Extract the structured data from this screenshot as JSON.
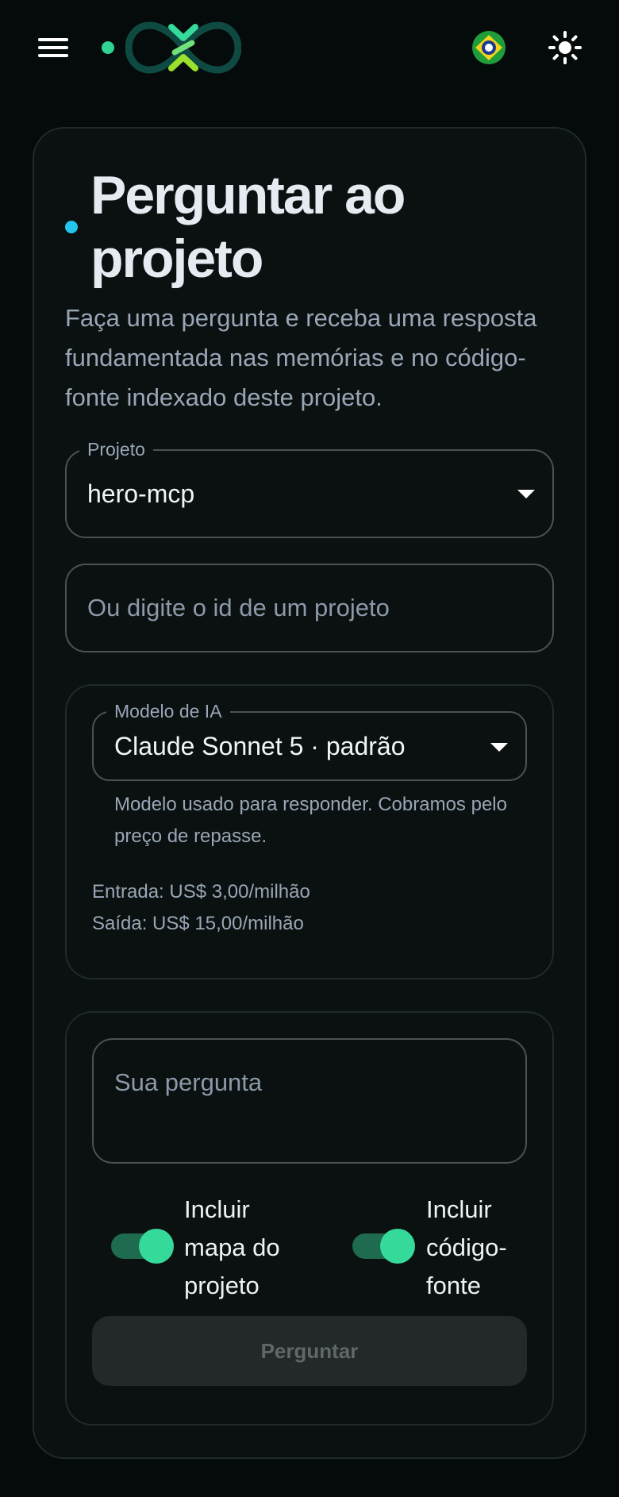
{
  "header": {
    "menu_icon": "hamburger-menu-icon",
    "status_color": "#2fd493",
    "logo_icon": "infinity-logo-icon",
    "language_icon": "brazil-flag-icon",
    "theme_icon": "sun-icon"
  },
  "page": {
    "title": "Perguntar ao projeto",
    "subtitle": "Faça uma pergunta e receba uma resposta fundamentada nas memórias e no código-fonte indexado deste projeto.",
    "accent_color": "#22c5ee"
  },
  "project": {
    "legend": "Projeto",
    "value": "hero-mcp",
    "id_placeholder": "Ou digite o id de um projeto"
  },
  "model": {
    "legend": "Modelo de IA",
    "value": "Claude Sonnet 5 · padrão",
    "helper": "Modelo usado para responder. Cobramos pelo preço de repasse.",
    "price_input": "Entrada: US$ 3,00/milhão",
    "price_output": "Saída: US$ 15,00/milhão"
  },
  "question": {
    "placeholder": "Sua pergunta",
    "toggle_map_label": "Incluir mapa do projeto",
    "toggle_map_on": true,
    "toggle_code_label": "Incluir código-fonte",
    "toggle_code_on": true,
    "submit_label": "Perguntar"
  },
  "colors": {
    "background": "#050a0a",
    "toggle_on": "#35d99a"
  }
}
